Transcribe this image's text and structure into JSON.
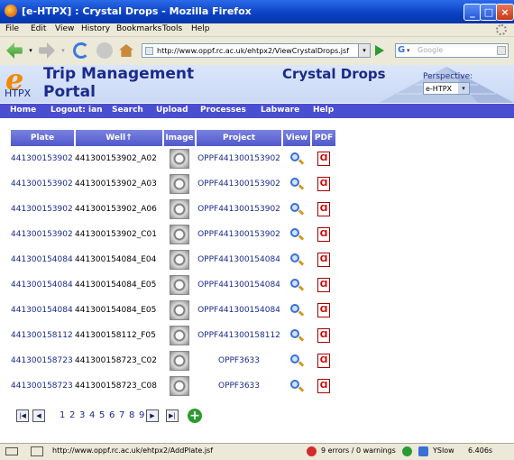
{
  "window": {
    "title": "[e-HTPX] : Crystal Drops - Mozilla Firefox"
  },
  "menubar": [
    "File",
    "Edit",
    "View",
    "History",
    "Bookmarks",
    "Tools",
    "Help"
  ],
  "nav": {
    "url": "http://www.oppf.rc.ac.uk/ehtpx2/ViewCrystalDrops.jsf",
    "search_placeholder": "Google"
  },
  "header": {
    "logo_e": "e",
    "logo_htpx": "HTPX",
    "title_line1": "Trip Management",
    "title_line2": "Portal",
    "page_title": "Crystal Drops",
    "perspective_label": "Perspective:",
    "perspective_value": "e-HTPX"
  },
  "menu": [
    "Home",
    "Logout: ian",
    "Search",
    "Upload",
    "Processes",
    "Labware",
    "Help"
  ],
  "table": {
    "headers": [
      "Plate",
      "Well↑",
      "Image",
      "Project",
      "View",
      "PDF"
    ],
    "rows": [
      {
        "plate": "441300153902",
        "well": "441300153902_A02",
        "project": "OPPF441300153902"
      },
      {
        "plate": "441300153902",
        "well": "441300153902_A03",
        "project": "OPPF441300153902"
      },
      {
        "plate": "441300153902",
        "well": "441300153902_A06",
        "project": "OPPF441300153902"
      },
      {
        "plate": "441300153902",
        "well": "441300153902_C01",
        "project": "OPPF441300153902"
      },
      {
        "plate": "441300154084",
        "well": "441300154084_E04",
        "project": "OPPF441300154084"
      },
      {
        "plate": "441300154084",
        "well": "441300154084_E05",
        "project": "OPPF441300154084"
      },
      {
        "plate": "441300154084",
        "well": "441300154084_E05",
        "project": "OPPF441300154084"
      },
      {
        "plate": "441300158112",
        "well": "441300158112_F05",
        "project": "OPPF441300158112"
      },
      {
        "plate": "441300158723",
        "well": "441300158723_C02",
        "project": "OPPF3633"
      },
      {
        "plate": "441300158723",
        "well": "441300158723_C08",
        "project": "OPPF3633"
      }
    ]
  },
  "pager": {
    "pages": [
      "1",
      "2",
      "3",
      "4",
      "5",
      "6",
      "7",
      "8",
      "9"
    ]
  },
  "status": {
    "url": "http://www.oppf.rc.ac.uk/ehtpx2/AddPlate.jsf",
    "errors": "9 errors / 0 warnings",
    "yslow": "YSlow",
    "size": "6.406s"
  }
}
